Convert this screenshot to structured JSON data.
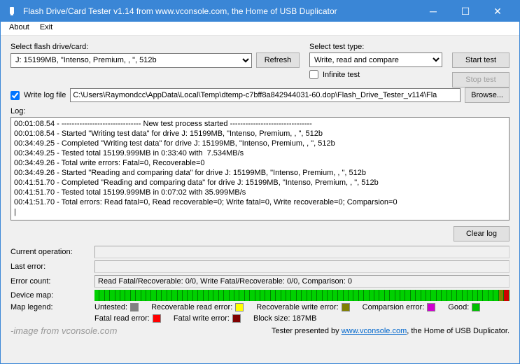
{
  "window": {
    "title": "Flash Drive/Card Tester v1.14 from www.vconsole.com, the Home of USB Duplicator"
  },
  "menu": {
    "about": "About",
    "exit": "Exit"
  },
  "top": {
    "select_drive_label": "Select flash drive/card:",
    "drive_value": "J: 15199MB, \"Intenso, Premium, , \", 512b",
    "refresh": "Refresh",
    "select_test_label": "Select test type:",
    "test_value": "Write, read and compare",
    "infinite": "Infinite test",
    "start": "Start test",
    "stop": "Stop test"
  },
  "logfile": {
    "checkbox_label": "Write log file",
    "path": "C:\\Users\\Raymondcc\\AppData\\Local\\Temp\\dtemp-c7bff8a842944031-60.dop\\Flash_Drive_Tester_v114\\Fla",
    "browse": "Browse..."
  },
  "log": {
    "label": "Log:",
    "text": "00:01:08.54 - ------------------------------- New test process started --------------------------------\n00:01:08.54 - Started \"Writing test data\" for drive J: 15199MB, \"Intenso, Premium, , \", 512b\n00:34:49.25 - Completed \"Writing test data\" for drive J: 15199MB, \"Intenso, Premium, , \", 512b\n00:34:49.25 - Tested total 15199.999MB in 0:33:40 with  7.534MB/s\n00:34:49.26 - Total write errors: Fatal=0, Recoverable=0\n00:34:49.26 - Started \"Reading and comparing data\" for drive J: 15199MB, \"Intenso, Premium, , \", 512b\n00:41:51.70 - Completed \"Reading and comparing data\" for drive J: 15199MB, \"Intenso, Premium, , \", 512b\n00:41:51.70 - Tested total 15199.999MB in 0:07:02 with 35.999MB/s\n00:41:51.70 - Total errors: Read fatal=0, Read recoverable=0; Write fatal=0, Write recoverable=0; Comparsion=0\n|",
    "clear": "Clear log"
  },
  "status": {
    "current_op_label": "Current operation:",
    "current_op": "",
    "last_error_label": "Last error:",
    "last_error": "",
    "error_count_label": "Error count:",
    "error_count": "Read Fatal/Recoverable: 0/0, Write Fatal/Recoverable: 0/0, Comparison: 0",
    "device_map_label": "Device map:"
  },
  "legend": {
    "label": "Map legend:",
    "untested": "Untested:",
    "recov_read": "Recoverable read error:",
    "recov_write": "Recoverable write error:",
    "comparison": "Comparsion error:",
    "good": "Good:",
    "fatal_read": "Fatal read error:",
    "fatal_write": "Fatal write error:",
    "block_size": "Block size: 187MB"
  },
  "footer": {
    "source_note": "-image from vconsole.com",
    "presented_pre": "Tester presented by ",
    "presented_link": "www.vconsole.com",
    "presented_post": ", the Home of USB Duplicator."
  },
  "colors": {
    "untested": "#808080",
    "good": "#00c000",
    "recov_read": "#ffff00",
    "fatal_read": "#ff0000",
    "recov_write": "#808000",
    "fatal_write": "#800000",
    "comparison": "#d000d0"
  }
}
